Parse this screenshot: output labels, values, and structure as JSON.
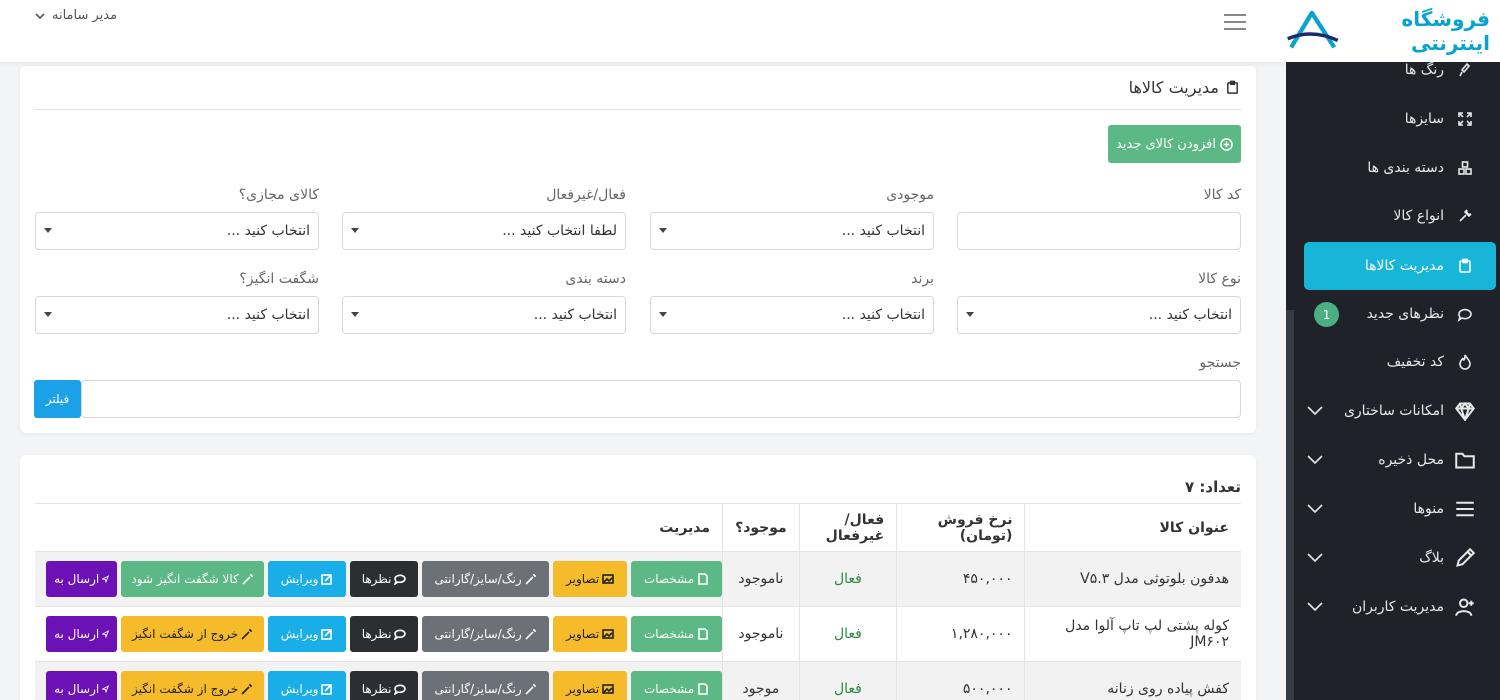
{
  "header": {
    "user_label": "مدیر سامانه"
  },
  "brand": {
    "logo_text": "فروشگاه اینترنتی",
    "accent_color": "#17b6d8"
  },
  "sidebar": {
    "items": [
      {
        "label": "رنگ ها",
        "icon": "brush-icon"
      },
      {
        "label": "سایزها",
        "icon": "resize-icon"
      },
      {
        "label": "دسته بندی ها",
        "icon": "grid-icon"
      },
      {
        "label": "انواع کالا",
        "icon": "tools-icon"
      },
      {
        "label": "مدیریت کالاها",
        "icon": "clipboard-icon",
        "active": true
      },
      {
        "label": "نظرهای جدید",
        "icon": "comment-icon",
        "badge": "1"
      },
      {
        "label": "کد تخفیف",
        "icon": "fire-icon"
      },
      {
        "label": "امکانات ساختاری",
        "icon": "diamond-icon",
        "expandable": true
      },
      {
        "label": "محل ذخیره",
        "icon": "folder-icon",
        "expandable": true
      },
      {
        "label": "منوها",
        "icon": "menu-icon",
        "expandable": true
      },
      {
        "label": "بلاگ",
        "icon": "pen-icon",
        "expandable": true
      },
      {
        "label": "مدیریت کاربران",
        "icon": "user-plus-icon",
        "expandable": true
      }
    ]
  },
  "filter_card": {
    "title": "مدیریت کالاها",
    "add_button": "افزودن کالای جدید",
    "fields": {
      "code": {
        "label": "کد کالا",
        "value": ""
      },
      "stock": {
        "label": "موجودی",
        "value": "انتخاب کنید ..."
      },
      "active": {
        "label": "فعال/غیرفعال",
        "value": "لطفا انتخاب کنید ..."
      },
      "virtual": {
        "label": "کالای مجازی؟",
        "value": "انتخاب کنید ..."
      },
      "type": {
        "label": "نوع کالا",
        "value": "انتخاب کنید ..."
      },
      "brand": {
        "label": "برند",
        "value": "انتخاب کنید ..."
      },
      "category": {
        "label": "دسته بندی",
        "value": "انتخاب کنید ..."
      },
      "amazing": {
        "label": "شگفت انگیز؟",
        "value": "انتخاب کنید ..."
      },
      "search": {
        "label": "جستجو",
        "value": ""
      }
    },
    "filter_button": "فیلتر"
  },
  "list_card": {
    "count_label": "تعداد: ۷",
    "columns": [
      "عنوان کالا",
      "نرخ فروش (تومان)",
      "فعال/غیرفعال",
      "موجود؟",
      "مدیریت"
    ],
    "rows": [
      {
        "title": "هدفون بلوتوثی مدل V۵.۳",
        "price": "۴۵۰,۰۰۰",
        "active": "فعال",
        "stock": "ناموجود",
        "stock_ok": false,
        "amazing_action": "کالا شگفت انگیز شود"
      },
      {
        "title": "کوله پشتی لپ تاپ آلوا مدل JM۶۰۲",
        "price": "۱,۲۸۰,۰۰۰",
        "active": "فعال",
        "stock": "ناموجود",
        "stock_ok": false,
        "amazing_action": "خروج از شگفت انگیز"
      },
      {
        "title": "کفش پیاده روی زنانه",
        "price": "۵۰۰,۰۰۰",
        "active": "فعال",
        "stock": "موجود",
        "stock_ok": true,
        "amazing_action": "خروج از شگفت انگیز"
      }
    ],
    "actions": {
      "specs": "مشخصات",
      "images": "تصاویر",
      "attributes": "رنگ/سایز/گارانتی",
      "comments": "نظرها",
      "edit": "ویرایش",
      "send": "ارسال به"
    }
  }
}
